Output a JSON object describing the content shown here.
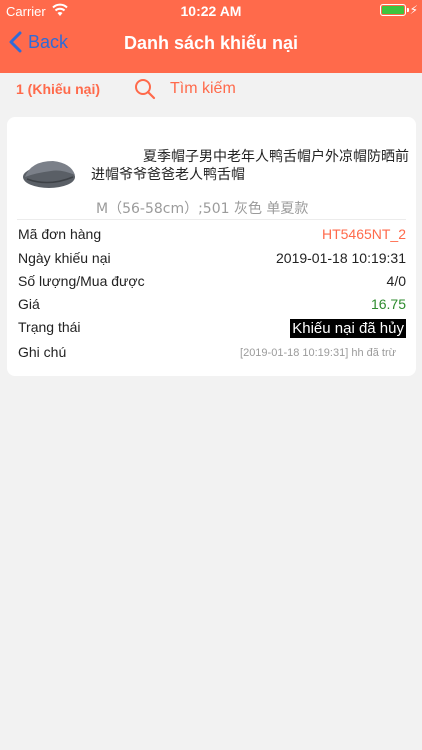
{
  "status_bar": {
    "carrier": "Carrier",
    "time": "10:22 AM"
  },
  "nav": {
    "back_label": "Back",
    "title": "Danh sách khiếu nại"
  },
  "search": {
    "count_label": "1 (Khiếu nại)",
    "placeholder": "Tìm kiếm"
  },
  "complaint": {
    "product_title": "夏季帽子男中老年人鸭舌帽户外凉帽防晒前进帽爷爷爸爸老人鸭舌帽",
    "variant": "M（56-58cm）;501 灰色 单夏款",
    "fields": {
      "order_label": "Mã đơn hàng",
      "order_value": "HT5465NT_2",
      "date_label": "Ngày khiếu nại",
      "date_value": "2019-01-18 10:19:31",
      "qty_label": "Số lượng/Mua được",
      "qty_value": "4/0",
      "price_label": "Giá",
      "price_value": "16.75",
      "status_label": "Trạng thái",
      "status_value": "Khiếu nại đã hủy",
      "note_label": "Ghi chú",
      "note_value": "[2019-01-18 10:19:31] hh đã trừ"
    }
  },
  "colors": {
    "accent": "#ff6a4b",
    "link": "#2f6bd8",
    "price": "#2e8b2e",
    "muted": "#9b9b9b"
  }
}
